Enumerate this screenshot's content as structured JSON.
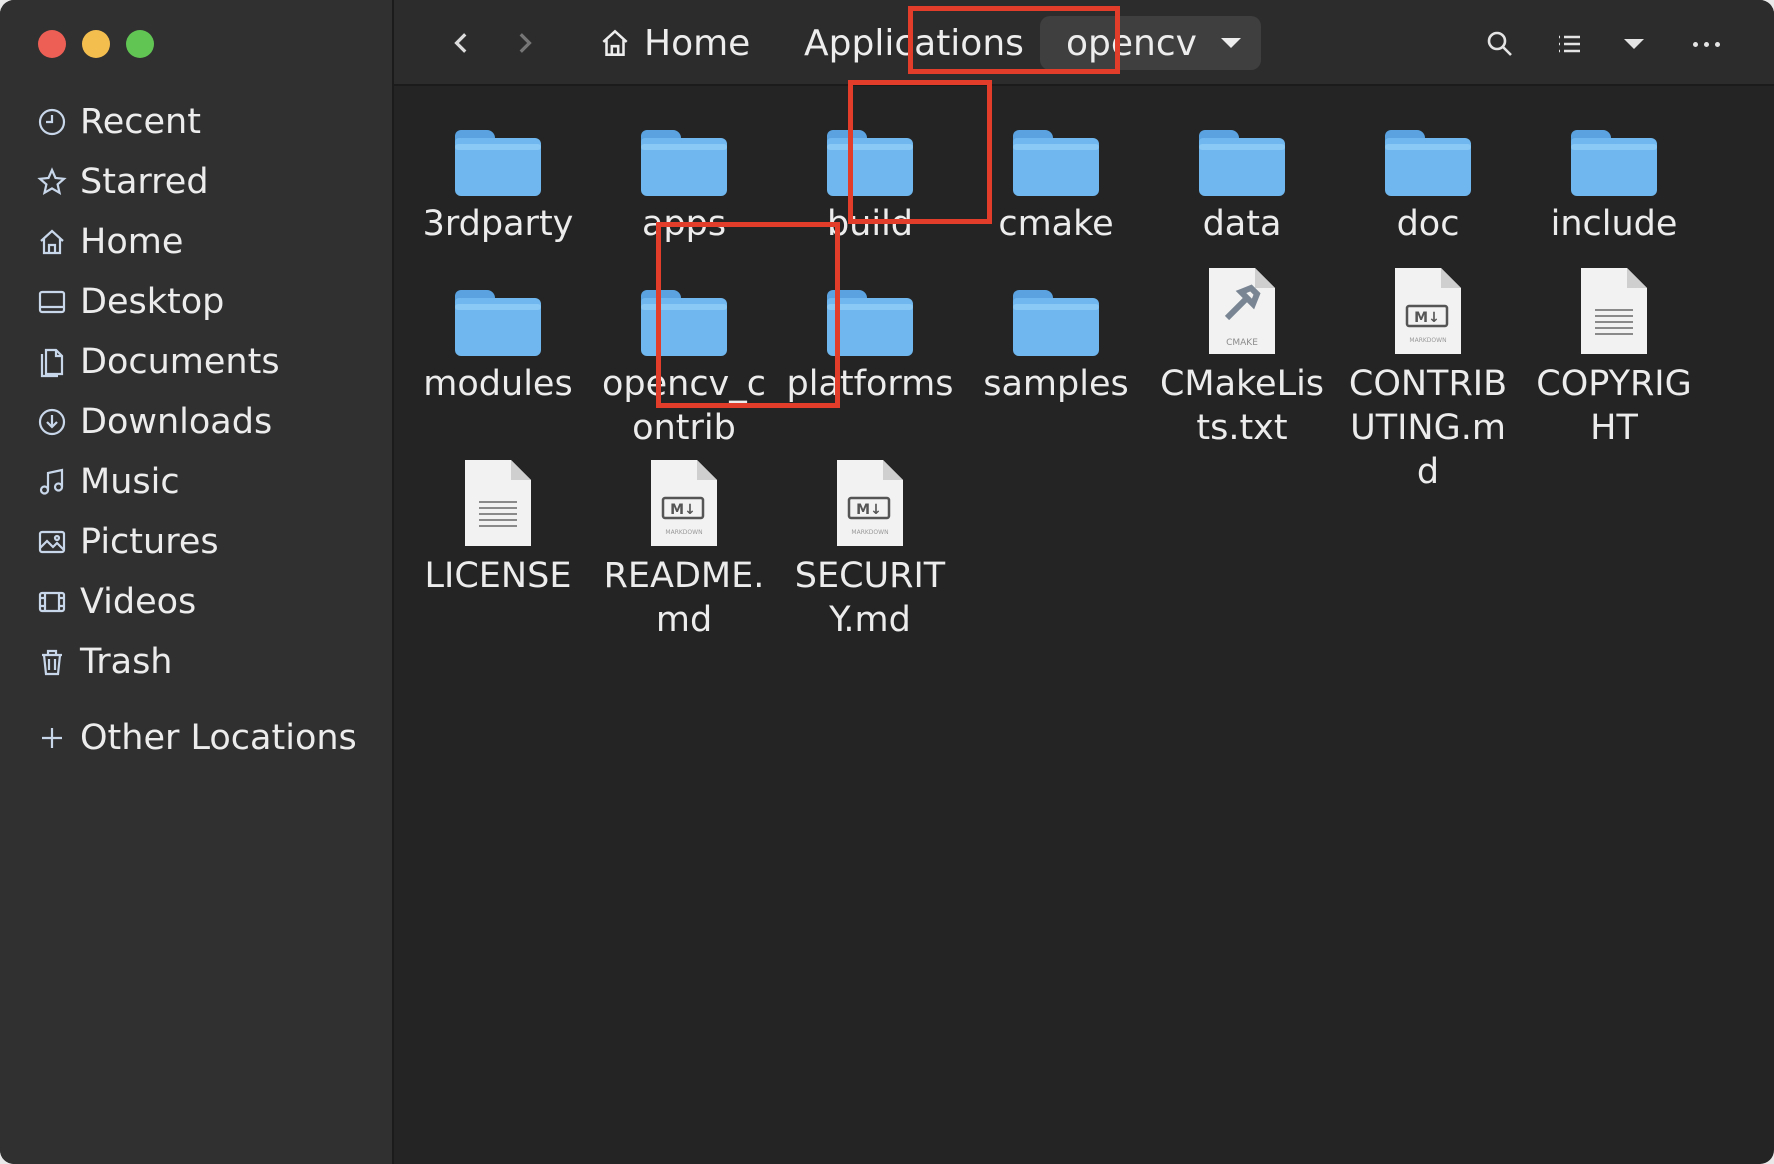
{
  "window": {
    "traffic_lights": [
      "close",
      "minimize",
      "zoom"
    ]
  },
  "sidebar": {
    "items": [
      {
        "label": "Recent",
        "icon": "clock-icon"
      },
      {
        "label": "Starred",
        "icon": "star-icon"
      },
      {
        "label": "Home",
        "icon": "home-icon"
      },
      {
        "label": "Desktop",
        "icon": "desktop-icon"
      },
      {
        "label": "Documents",
        "icon": "documents-icon"
      },
      {
        "label": "Downloads",
        "icon": "download-icon"
      },
      {
        "label": "Music",
        "icon": "music-icon"
      },
      {
        "label": "Pictures",
        "icon": "pictures-icon"
      },
      {
        "label": "Videos",
        "icon": "videos-icon"
      },
      {
        "label": "Trash",
        "icon": "trash-icon"
      }
    ],
    "other_locations": "Other Locations"
  },
  "header": {
    "breadcrumb": {
      "home": "Home",
      "parent": "Applications",
      "current": "opencv"
    },
    "tools": [
      "search-icon",
      "list-view-icon",
      "view-options-icon",
      "more-options-icon"
    ]
  },
  "files": [
    {
      "name": "3rdparty",
      "type": "folder"
    },
    {
      "name": "apps",
      "type": "folder"
    },
    {
      "name": "build",
      "type": "folder"
    },
    {
      "name": "cmake",
      "type": "folder"
    },
    {
      "name": "data",
      "type": "folder"
    },
    {
      "name": "doc",
      "type": "folder"
    },
    {
      "name": "include",
      "type": "folder"
    },
    {
      "name": "modules",
      "type": "folder"
    },
    {
      "name": "opencv_contrib",
      "type": "folder"
    },
    {
      "name": "platforms",
      "type": "folder"
    },
    {
      "name": "samples",
      "type": "folder"
    },
    {
      "name": "CMakeLists.txt",
      "type": "cmake",
      "badge": "CMAKE"
    },
    {
      "name": "CONTRIBUTING.md",
      "type": "markdown",
      "badge": "M↓",
      "caption": "MARKDOWN"
    },
    {
      "name": "COPYRIGHT",
      "type": "text"
    },
    {
      "name": "LICENSE",
      "type": "text"
    },
    {
      "name": "README.md",
      "type": "markdown",
      "badge": "M↓",
      "caption": "MARKDOWN"
    },
    {
      "name": "SECURITY.md",
      "type": "markdown",
      "badge": "M↓",
      "caption": "MARKDOWN"
    }
  ],
  "highlight_color": "#e23c2a",
  "highlighted": [
    "opencv",
    "build",
    "opencv_contrib"
  ]
}
